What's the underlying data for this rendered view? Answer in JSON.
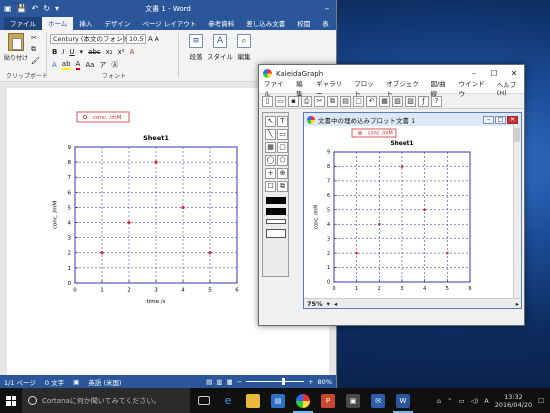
{
  "word": {
    "title": "文書 1 - Word",
    "tabs": [
      "ファイル",
      "ホーム",
      "挿入",
      "デザイン",
      "ページ レイアウト",
      "参考資料",
      "差し込み文書",
      "校閲",
      "表"
    ],
    "active_tab": "ホーム",
    "ribbon": {
      "paste_label": "貼り付け",
      "clipboard_label": "クリップボード",
      "font_name": "Century (本文のフォント)",
      "font_size": "10.5",
      "font_label": "フォント",
      "paragraph_label": "段落",
      "style_label": "スタイル",
      "edit_label": "編集"
    },
    "status": {
      "page": "1/1 ページ",
      "words": "0 文字",
      "language": "英語 (米国)",
      "zoom": "80%"
    }
  },
  "kaleida": {
    "title": "KaleidaGraph",
    "menu": [
      "ファイル",
      "編集",
      "ギャラリー",
      "プロット",
      "オブジェクト",
      "図/曲線",
      "ウインドウ",
      "ヘルプ(H)"
    ],
    "plot_window_title": "文書中の埋め込みプロット文書 1",
    "zoom": "75%"
  },
  "taskbar": {
    "search_placeholder": "Cortanaに何か聞いてみてください。",
    "time": "13:32",
    "date": "2016/04/20",
    "ime": "A"
  },
  "chart_data": [
    {
      "type": "scatter",
      "title": "Sheet1",
      "xlabel": "time /s",
      "ylabel": "conc. /mM",
      "legend": "conc. /mM",
      "legend_position": "top-left",
      "x": [
        1,
        2,
        3,
        4,
        5
      ],
      "y": [
        2,
        4,
        8,
        5,
        2
      ],
      "xlim": [
        0,
        6
      ],
      "ylim": [
        0,
        9
      ],
      "xticks": [
        "0",
        "1",
        "2",
        "3",
        "4",
        "5",
        "6"
      ],
      "yticks": [
        "0",
        "1",
        "2",
        "3",
        "4",
        "5",
        "6",
        "7",
        "8",
        "9"
      ],
      "grid": true,
      "marker_color": "#d03030",
      "axis_color": "#2222aa"
    },
    {
      "type": "scatter",
      "title": "Sheet1",
      "xlabel": "",
      "ylabel": "conc. /mM",
      "legend": "conc. /mM",
      "legend_position": "top-left",
      "x": [
        1,
        2,
        3,
        4,
        5
      ],
      "y": [
        2,
        4,
        8,
        5,
        2
      ],
      "xlim": [
        0,
        6
      ],
      "ylim": [
        0,
        9
      ],
      "xticks": [
        "0",
        "1",
        "2",
        "3",
        "4",
        "5",
        "6"
      ],
      "yticks": [
        "0",
        "1",
        "2",
        "3",
        "4",
        "5",
        "6",
        "7",
        "8",
        "9"
      ],
      "grid": true,
      "marker_color": "#d03030",
      "axis_color": "#2222aa"
    }
  ]
}
